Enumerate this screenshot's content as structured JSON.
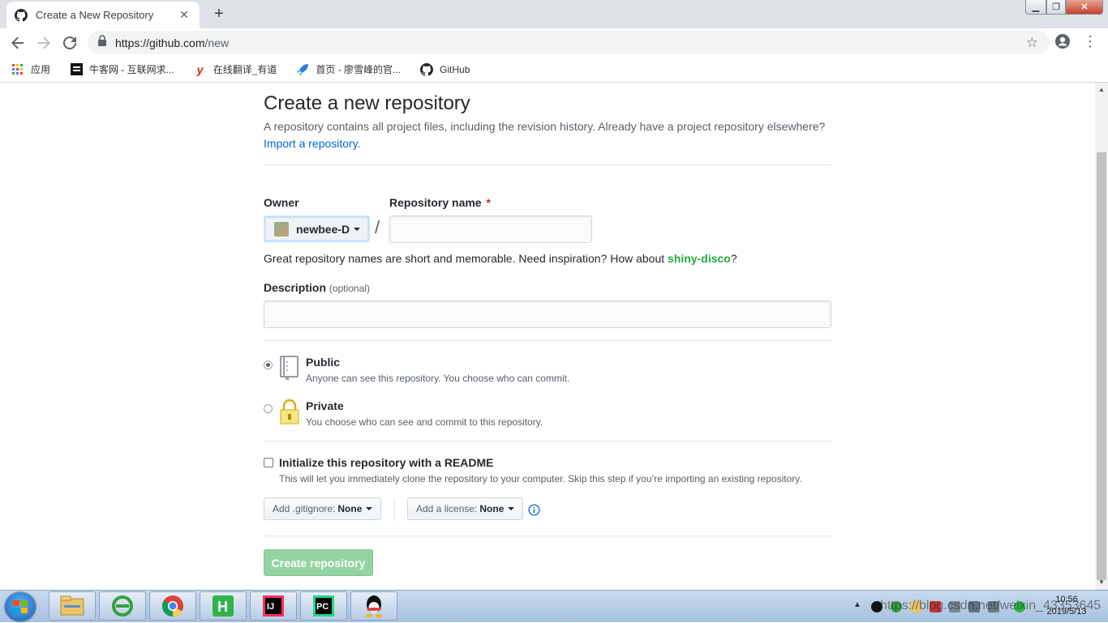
{
  "browser": {
    "tab_title": "Create a New Repository",
    "tab_close": "✕",
    "new_tab": "+",
    "url_host": "https://github.com",
    "url_path": "/new",
    "bookmarks": [
      {
        "label": "应用",
        "icon": "apps-grid-icon"
      },
      {
        "label": "牛客网 - 互联网求...",
        "icon": "nowcoder-icon"
      },
      {
        "label": "在线翻译_有道",
        "icon": "youdao-icon"
      },
      {
        "label": "首页 - 廖雪峰的官...",
        "icon": "rocket-icon"
      },
      {
        "label": "GitHub",
        "icon": "github-icon"
      }
    ]
  },
  "page": {
    "title": "Create a new repository",
    "subtitle": "A repository contains all project files, including the revision history. Already have a project repository elsewhere?",
    "import_link": "Import a repository.",
    "owner_label": "Owner",
    "owner_name": "newbee-D",
    "repo_name_label": "Repository name",
    "required_mark": "*",
    "slash": "/",
    "repo_name_value": "",
    "name_note_prefix": "Great repository names are short and memorable. Need inspiration? How about ",
    "name_suggestion": "shiny-disco",
    "name_note_suffix": "?",
    "description_label": "Description",
    "description_optional": "(optional)",
    "description_value": "",
    "visibility": {
      "selected": "public",
      "public_title": "Public",
      "public_desc": "Anyone can see this repository. You choose who can commit.",
      "private_title": "Private",
      "private_desc": "You choose who can see and commit to this repository."
    },
    "readme_checked": false,
    "readme_label": "Initialize this repository with a README",
    "readme_desc": "This will let you immediately clone the repository to your computer. Skip this step if you’re importing an existing repository.",
    "gitignore_label": "Add .gitignore:",
    "gitignore_value": "None",
    "license_label": "Add a license:",
    "license_value": "None",
    "create_button": "Create repository"
  },
  "taskbar": {
    "apps": [
      "file-explorer-icon",
      "ie-browser-icon",
      "chrome-icon",
      "hbuilder-icon",
      "intellij-icon",
      "pycharm-icon",
      "qq-icon"
    ],
    "clock_time": "10:56",
    "clock_date": "2019/5/13",
    "watermark": "https://blog.csdn.net/weixin_43353645"
  },
  "colors": {
    "link": "#0366d6",
    "suggestion": "#28a745",
    "create_button_disabled": "#94d3a2",
    "required": "#cb2431"
  }
}
